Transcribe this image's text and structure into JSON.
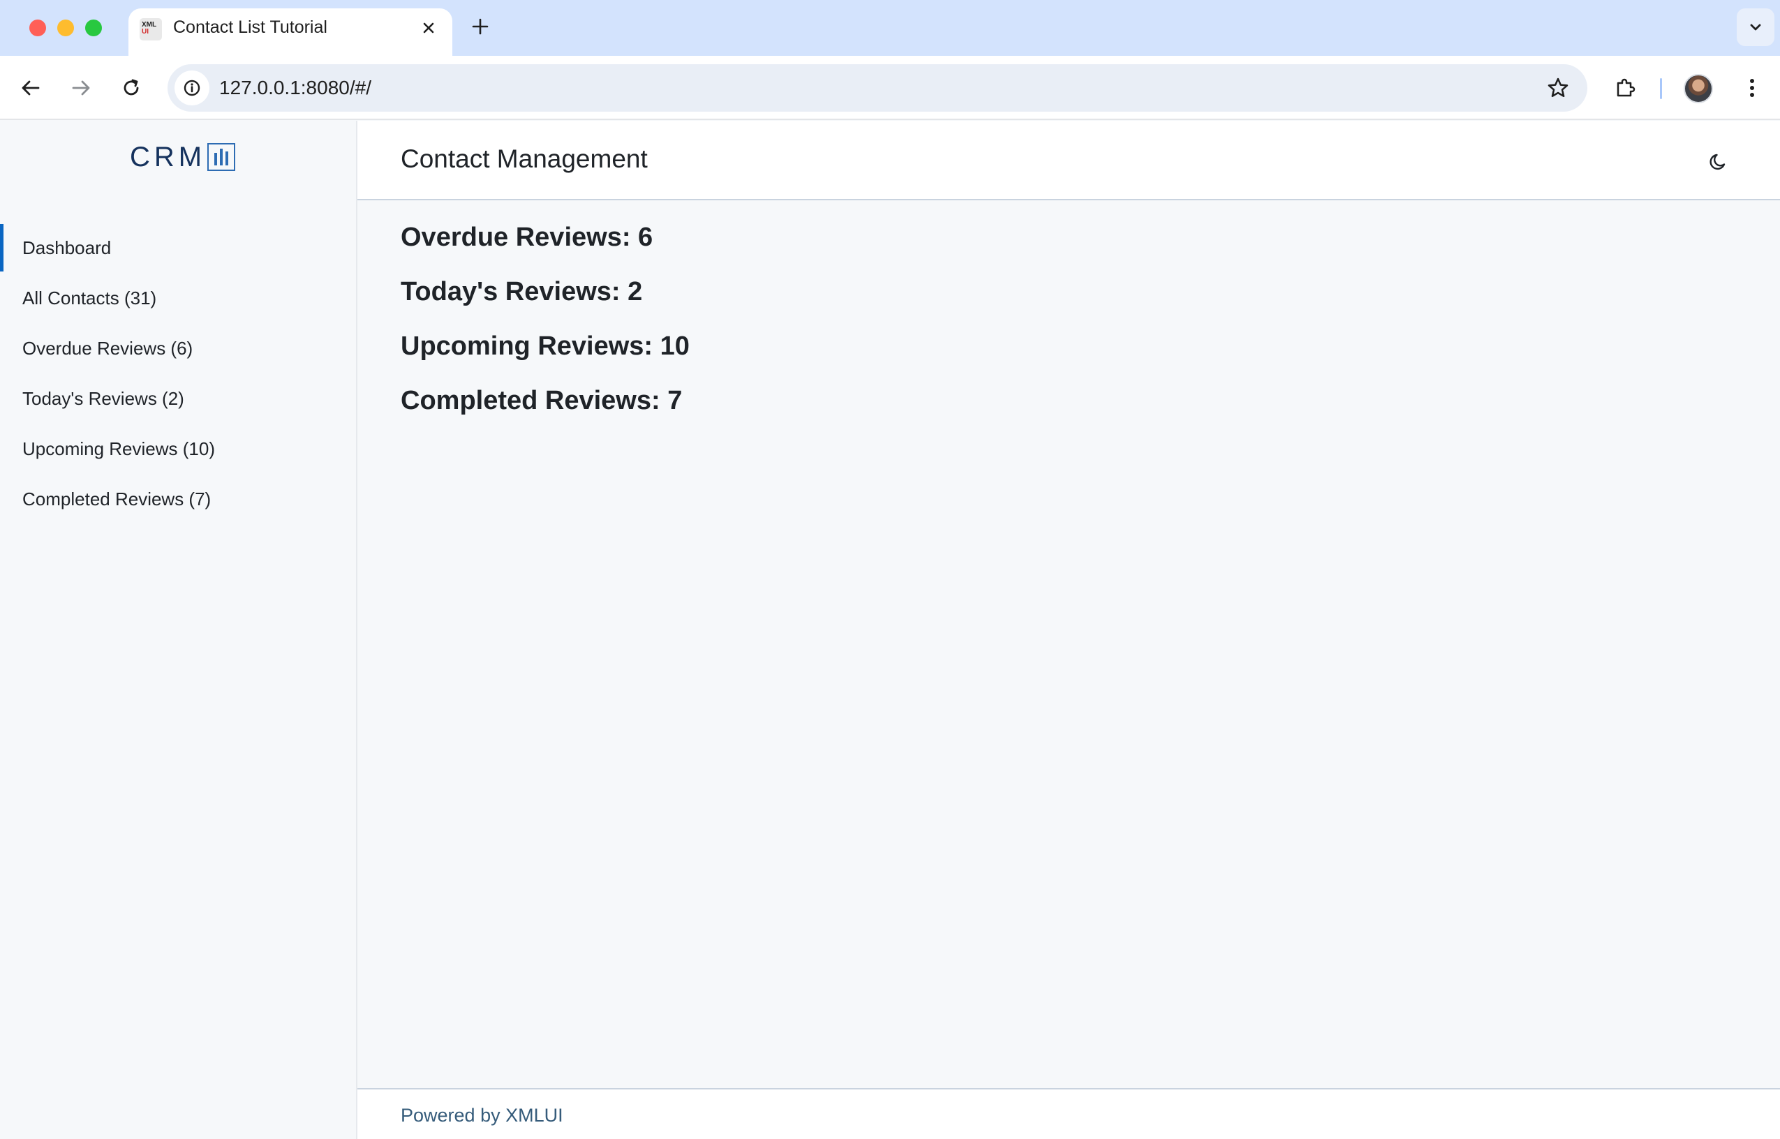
{
  "browser": {
    "tab_title": "Contact List Tutorial",
    "favicon_text_top": "XML",
    "favicon_text_bottom": "UI",
    "url": "127.0.0.1:8080/#/",
    "icons": [
      "close-icon",
      "plus-icon",
      "chevron-down-icon",
      "back-arrow-icon",
      "forward-arrow-icon",
      "reload-icon",
      "info-icon",
      "star-icon",
      "puzzle-icon",
      "kebab-menu-icon"
    ]
  },
  "app": {
    "logo_text": "CRM",
    "page_title": "Contact Management",
    "theme_icon": "moon-icon",
    "accent_color": "#0a66c2"
  },
  "sidebar": {
    "items": [
      {
        "label": "Dashboard",
        "active": true
      },
      {
        "label": "All Contacts (31)",
        "active": false
      },
      {
        "label": "Overdue Reviews (6)",
        "active": false
      },
      {
        "label": "Today's Reviews (2)",
        "active": false
      },
      {
        "label": "Upcoming Reviews (10)",
        "active": false
      },
      {
        "label": "Completed Reviews (7)",
        "active": false
      }
    ]
  },
  "dashboard": {
    "stats": [
      "Overdue Reviews: 6",
      "Today's Reviews: 2",
      "Upcoming Reviews: 10",
      "Completed Reviews: 7"
    ]
  },
  "footer": {
    "text": "Powered by XMLUI"
  }
}
